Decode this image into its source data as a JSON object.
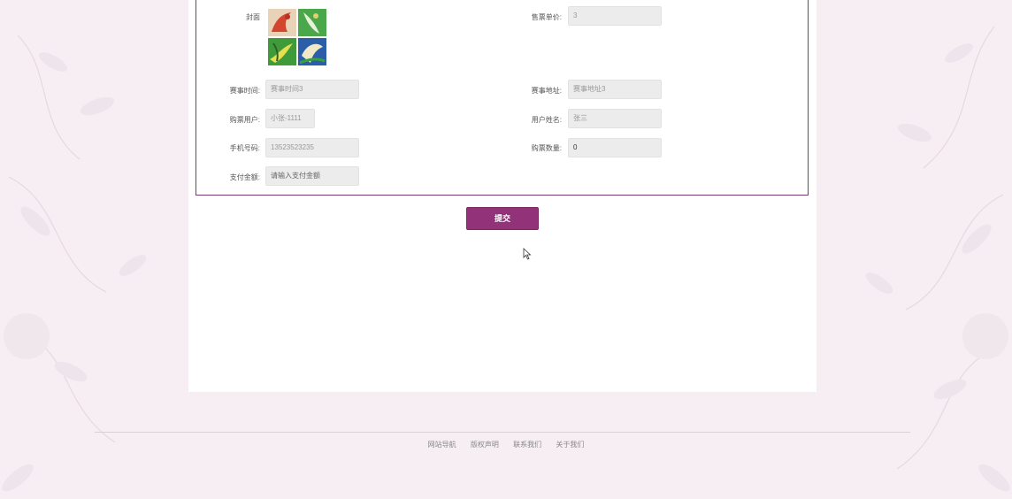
{
  "form": {
    "cover_label": "封面",
    "price_label": "售票单价:",
    "price_value": "3",
    "time_label": "赛事时间:",
    "time_value": "赛事时间3",
    "address_label": "赛事地址:",
    "address_value": "赛事地址3",
    "buyer_label": "购票用户:",
    "buyer_value": "小张-1111",
    "username_label": "用户姓名:",
    "username_value": "张三",
    "phone_label": "手机号码:",
    "phone_value": "13523523235",
    "quantity_label": "购票数量:",
    "quantity_value": "0",
    "amount_label": "支付金额:",
    "amount_placeholder": "请输入支付金额"
  },
  "submit_label": "提交",
  "footer": {
    "links": [
      "网站导航",
      "版权声明",
      "联系我们",
      "关于我们"
    ]
  },
  "colors": {
    "accent": "#923278",
    "border": "#7a3a78",
    "page_bg": "#f6eef3"
  }
}
